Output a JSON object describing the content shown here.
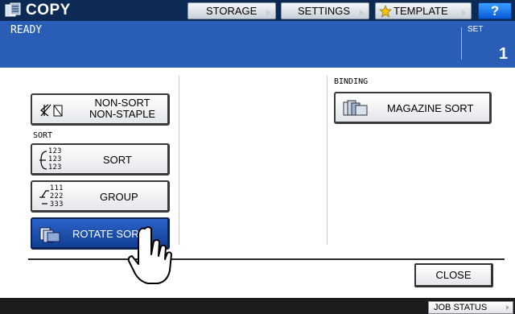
{
  "header": {
    "title": "COPY",
    "buttons": [
      {
        "label": "STORAGE"
      },
      {
        "label": "SETTINGS"
      },
      {
        "label": "TEMPLATE"
      }
    ],
    "help_label": "?"
  },
  "status": {
    "message": "READY",
    "set_label": "SET",
    "set_value": "1"
  },
  "sections": {
    "sort_label": "SORT",
    "binding_label": "BINDING"
  },
  "options": {
    "non_sort": {
      "line1": "NON-SORT",
      "line2": "NON-STAPLE"
    },
    "sort": {
      "label": "SORT",
      "icon_rows": [
        "123",
        "123",
        "123"
      ]
    },
    "group": {
      "label": "GROUP",
      "icon_rows": [
        "111",
        "222",
        "333"
      ]
    },
    "rotate_sort": {
      "label": "ROTATE SORT",
      "selected": true
    },
    "magazine_sort": {
      "label": "MAGAZINE SORT"
    }
  },
  "footer": {
    "close_label": "CLOSE",
    "job_status_label": "JOB STATUS"
  },
  "colors": {
    "top_bar": "#0d2a55",
    "status_bar": "#2a5db6",
    "selected_button": "#1f4fae"
  }
}
